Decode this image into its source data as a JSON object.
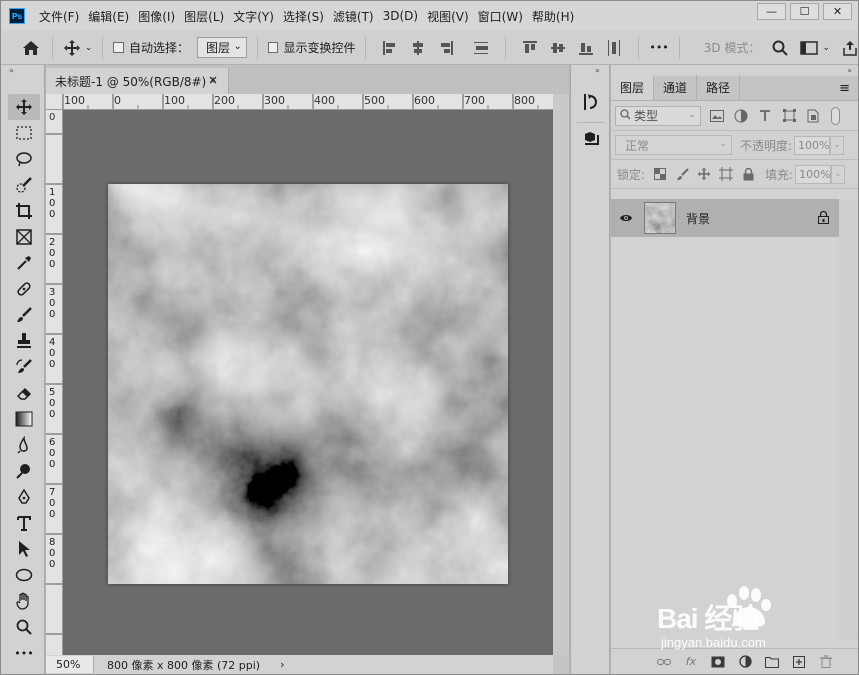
{
  "app": {
    "logo_text": "Ps"
  },
  "menu": [
    "文件(F)",
    "编辑(E)",
    "图像(I)",
    "图层(L)",
    "文字(Y)",
    "选择(S)",
    "滤镜(T)",
    "3D(D)",
    "视图(V)",
    "窗口(W)",
    "帮助(H)"
  ],
  "window_controls": {
    "minimize": "—",
    "maximize": "☐",
    "close": "✕"
  },
  "options": {
    "auto_select_label": "自动选择：",
    "auto_select_target": "图层",
    "show_transform_label": "显示变换控件",
    "mode_3d_label": "3D 模式：",
    "more": "•••"
  },
  "document": {
    "tab_title": "未标题-1 @ 50%(RGB/8#) *",
    "tab_close": "×",
    "zoom": "50%",
    "doc_info": "800 像素 x 800 像素 (72 ppi)",
    "status_arrow": "›"
  },
  "rulers": {
    "h_ticks": [
      "100",
      "0",
      "100",
      "200",
      "300",
      "400",
      "500",
      "600",
      "700",
      "800"
    ],
    "v_ticks": [
      "0",
      "100",
      "200",
      "300",
      "400",
      "500",
      "600",
      "700",
      "800"
    ]
  },
  "layers_panel": {
    "tabs": [
      "图层",
      "通道",
      "路径"
    ],
    "active_tab": "图层",
    "menu_icon": "≡",
    "filter_kind": "类型",
    "blend_mode": "正常",
    "opacity_label": "不透明度:",
    "opacity_value": "100%",
    "lock_label": "锁定:",
    "fill_label": "填充:",
    "fill_value": "100%",
    "layers": [
      {
        "name": "背景",
        "visible": true,
        "locked": true
      }
    ]
  },
  "watermark": {
    "brand": "Bai  经验",
    "url": "jingyan.baidu.com"
  },
  "colors": {
    "canvas_bg": "#6b6b6b",
    "ps_blue": "#31a8ff",
    "ps_dark": "#001e36"
  }
}
